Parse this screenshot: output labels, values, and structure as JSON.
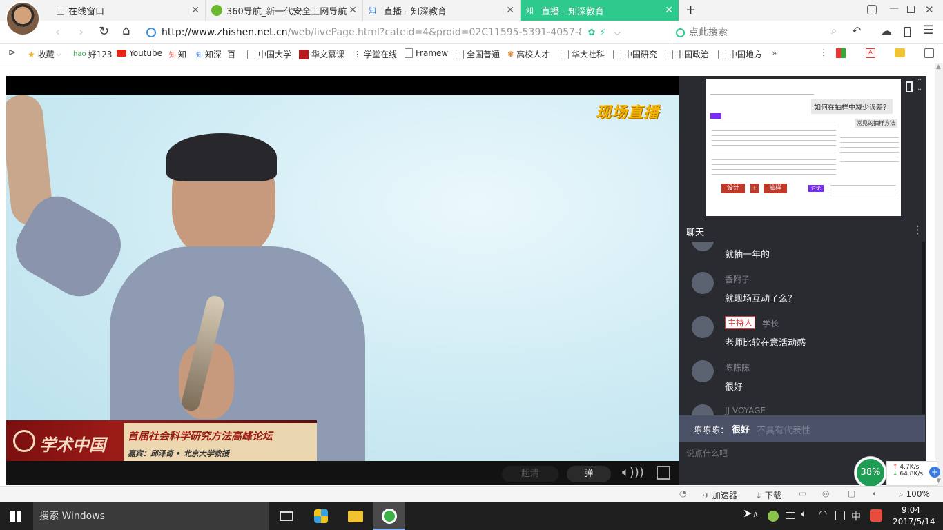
{
  "tabs": [
    {
      "label": "在线窗口",
      "icon": "page-icon"
    },
    {
      "label": "360导航_新一代安全上网导航",
      "icon": "360-icon"
    },
    {
      "label": "直播 - 知深教育",
      "icon": "zhishen-icon"
    },
    {
      "label": "直播 - 知深教育",
      "icon": "zhishen-icon",
      "active": true
    }
  ],
  "nav": {
    "url_host": "http://www.zhishen.net.cn",
    "url_path": "/web/livePage.html?cateid=4&proid=02C11595-5391-4057-871",
    "search_placeholder": "点此搜索"
  },
  "bookmarks": [
    "收藏",
    "好123",
    "Youtube",
    "知",
    "知深- 百",
    "中国大学",
    "华文慕课",
    "学堂在线",
    "Framew",
    "全国普通",
    "高校人才",
    "华大社科",
    "中国研究",
    "中国政治",
    "中国地方",
    "»"
  ],
  "video": {
    "live_badge": "现场直播",
    "banner_logo": "学术中国",
    "banner_title": "首届社会科学研究方法高峰论坛",
    "banner_guest": "嘉宾：邱泽奇 • 北京大学教授"
  },
  "controls": {
    "quality": "超清",
    "danmaku": "弹"
  },
  "slide": {
    "question": "如何在抽样中减少误差？",
    "heading_right": "常见的抽样方法",
    "chip_left": "设计",
    "chip_mid": "+",
    "chip_right": "抽样",
    "chip_discuss": "讨论"
  },
  "chat": {
    "title": "聊天",
    "messages": [
      {
        "name": "",
        "text": "就抽一年的"
      },
      {
        "name": "香附子",
        "text": "就现场互动了么？"
      },
      {
        "name": "学长",
        "badge": "主持人",
        "text": "老师比较在意活动感"
      },
      {
        "name": "陈陈陈",
        "text": "很好"
      },
      {
        "name": "JJ VOYAGE",
        "text": "不具有代表性"
      }
    ],
    "overlay_name": "陈陈陈：",
    "overlay_text": "很好",
    "input_placeholder": "说点什么吧"
  },
  "speed": {
    "percent": "38%",
    "up": "4.7K/s",
    "down": "64.8K/s"
  },
  "status": {
    "accelerator": "加速器",
    "download": "下载",
    "zoom": "100%"
  },
  "taskbar": {
    "search": "搜索 Windows",
    "time": "9:04",
    "date": "2017/5/14",
    "ime": "中"
  },
  "colors": {
    "active_tab": "#2ec98c",
    "badge_red": "#e0393e",
    "taskbar": "#1f1f1f"
  }
}
